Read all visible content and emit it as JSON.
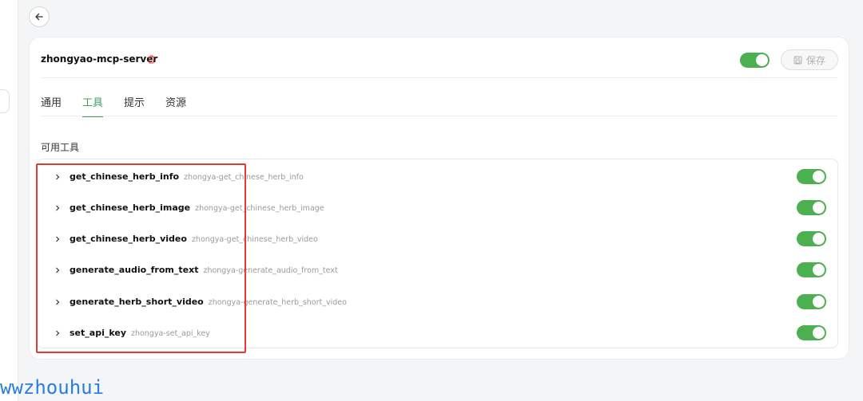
{
  "server": {
    "name": "zhongyao-mcp-server",
    "enabled": true,
    "save_label": "保存"
  },
  "tabs": [
    {
      "label": "通用",
      "active": false
    },
    {
      "label": "工具",
      "active": true
    },
    {
      "label": "提示",
      "active": false
    },
    {
      "label": "资源",
      "active": false
    }
  ],
  "section_title": "可用工具",
  "tools": [
    {
      "name": "get_chinese_herb_info",
      "id": "zhongya-get_chinese_herb_info",
      "enabled": true
    },
    {
      "name": "get_chinese_herb_image",
      "id": "zhongya-get_chinese_herb_image",
      "enabled": true
    },
    {
      "name": "get_chinese_herb_video",
      "id": "zhongya-get_chinese_herb_video",
      "enabled": true
    },
    {
      "name": "generate_audio_from_text",
      "id": "zhongya-generate_audio_from_text",
      "enabled": true
    },
    {
      "name": "generate_herb_short_video",
      "id": "zhongya-generate_herb_short_video",
      "enabled": true
    },
    {
      "name": "set_api_key",
      "id": "zhongya-set_api_key",
      "enabled": true
    }
  ],
  "colors": {
    "accent": "#3aa45c",
    "toggle_on": "#4caf50",
    "highlight": "#e53935",
    "delete_icon": "#e53935"
  },
  "watermark": "wwzhouhui"
}
